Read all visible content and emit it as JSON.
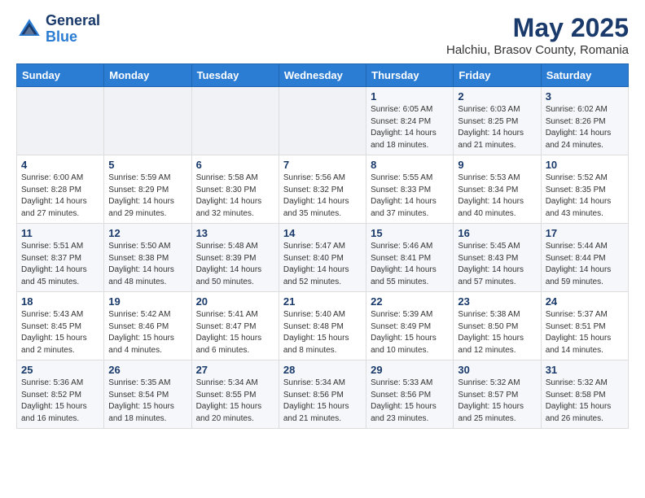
{
  "logo": {
    "line1": "General",
    "line2": "Blue"
  },
  "title": "May 2025",
  "subtitle": "Halchiu, Brasov County, Romania",
  "days_of_week": [
    "Sunday",
    "Monday",
    "Tuesday",
    "Wednesday",
    "Thursday",
    "Friday",
    "Saturday"
  ],
  "weeks": [
    [
      {
        "day": "",
        "info": ""
      },
      {
        "day": "",
        "info": ""
      },
      {
        "day": "",
        "info": ""
      },
      {
        "day": "",
        "info": ""
      },
      {
        "day": "1",
        "info": "Sunrise: 6:05 AM\nSunset: 8:24 PM\nDaylight: 14 hours\nand 18 minutes."
      },
      {
        "day": "2",
        "info": "Sunrise: 6:03 AM\nSunset: 8:25 PM\nDaylight: 14 hours\nand 21 minutes."
      },
      {
        "day": "3",
        "info": "Sunrise: 6:02 AM\nSunset: 8:26 PM\nDaylight: 14 hours\nand 24 minutes."
      }
    ],
    [
      {
        "day": "4",
        "info": "Sunrise: 6:00 AM\nSunset: 8:28 PM\nDaylight: 14 hours\nand 27 minutes."
      },
      {
        "day": "5",
        "info": "Sunrise: 5:59 AM\nSunset: 8:29 PM\nDaylight: 14 hours\nand 29 minutes."
      },
      {
        "day": "6",
        "info": "Sunrise: 5:58 AM\nSunset: 8:30 PM\nDaylight: 14 hours\nand 32 minutes."
      },
      {
        "day": "7",
        "info": "Sunrise: 5:56 AM\nSunset: 8:32 PM\nDaylight: 14 hours\nand 35 minutes."
      },
      {
        "day": "8",
        "info": "Sunrise: 5:55 AM\nSunset: 8:33 PM\nDaylight: 14 hours\nand 37 minutes."
      },
      {
        "day": "9",
        "info": "Sunrise: 5:53 AM\nSunset: 8:34 PM\nDaylight: 14 hours\nand 40 minutes."
      },
      {
        "day": "10",
        "info": "Sunrise: 5:52 AM\nSunset: 8:35 PM\nDaylight: 14 hours\nand 43 minutes."
      }
    ],
    [
      {
        "day": "11",
        "info": "Sunrise: 5:51 AM\nSunset: 8:37 PM\nDaylight: 14 hours\nand 45 minutes."
      },
      {
        "day": "12",
        "info": "Sunrise: 5:50 AM\nSunset: 8:38 PM\nDaylight: 14 hours\nand 48 minutes."
      },
      {
        "day": "13",
        "info": "Sunrise: 5:48 AM\nSunset: 8:39 PM\nDaylight: 14 hours\nand 50 minutes."
      },
      {
        "day": "14",
        "info": "Sunrise: 5:47 AM\nSunset: 8:40 PM\nDaylight: 14 hours\nand 52 minutes."
      },
      {
        "day": "15",
        "info": "Sunrise: 5:46 AM\nSunset: 8:41 PM\nDaylight: 14 hours\nand 55 minutes."
      },
      {
        "day": "16",
        "info": "Sunrise: 5:45 AM\nSunset: 8:43 PM\nDaylight: 14 hours\nand 57 minutes."
      },
      {
        "day": "17",
        "info": "Sunrise: 5:44 AM\nSunset: 8:44 PM\nDaylight: 14 hours\nand 59 minutes."
      }
    ],
    [
      {
        "day": "18",
        "info": "Sunrise: 5:43 AM\nSunset: 8:45 PM\nDaylight: 15 hours\nand 2 minutes."
      },
      {
        "day": "19",
        "info": "Sunrise: 5:42 AM\nSunset: 8:46 PM\nDaylight: 15 hours\nand 4 minutes."
      },
      {
        "day": "20",
        "info": "Sunrise: 5:41 AM\nSunset: 8:47 PM\nDaylight: 15 hours\nand 6 minutes."
      },
      {
        "day": "21",
        "info": "Sunrise: 5:40 AM\nSunset: 8:48 PM\nDaylight: 15 hours\nand 8 minutes."
      },
      {
        "day": "22",
        "info": "Sunrise: 5:39 AM\nSunset: 8:49 PM\nDaylight: 15 hours\nand 10 minutes."
      },
      {
        "day": "23",
        "info": "Sunrise: 5:38 AM\nSunset: 8:50 PM\nDaylight: 15 hours\nand 12 minutes."
      },
      {
        "day": "24",
        "info": "Sunrise: 5:37 AM\nSunset: 8:51 PM\nDaylight: 15 hours\nand 14 minutes."
      }
    ],
    [
      {
        "day": "25",
        "info": "Sunrise: 5:36 AM\nSunset: 8:52 PM\nDaylight: 15 hours\nand 16 minutes."
      },
      {
        "day": "26",
        "info": "Sunrise: 5:35 AM\nSunset: 8:54 PM\nDaylight: 15 hours\nand 18 minutes."
      },
      {
        "day": "27",
        "info": "Sunrise: 5:34 AM\nSunset: 8:55 PM\nDaylight: 15 hours\nand 20 minutes."
      },
      {
        "day": "28",
        "info": "Sunrise: 5:34 AM\nSunset: 8:56 PM\nDaylight: 15 hours\nand 21 minutes."
      },
      {
        "day": "29",
        "info": "Sunrise: 5:33 AM\nSunset: 8:56 PM\nDaylight: 15 hours\nand 23 minutes."
      },
      {
        "day": "30",
        "info": "Sunrise: 5:32 AM\nSunset: 8:57 PM\nDaylight: 15 hours\nand 25 minutes."
      },
      {
        "day": "31",
        "info": "Sunrise: 5:32 AM\nSunset: 8:58 PM\nDaylight: 15 hours\nand 26 minutes."
      }
    ]
  ]
}
